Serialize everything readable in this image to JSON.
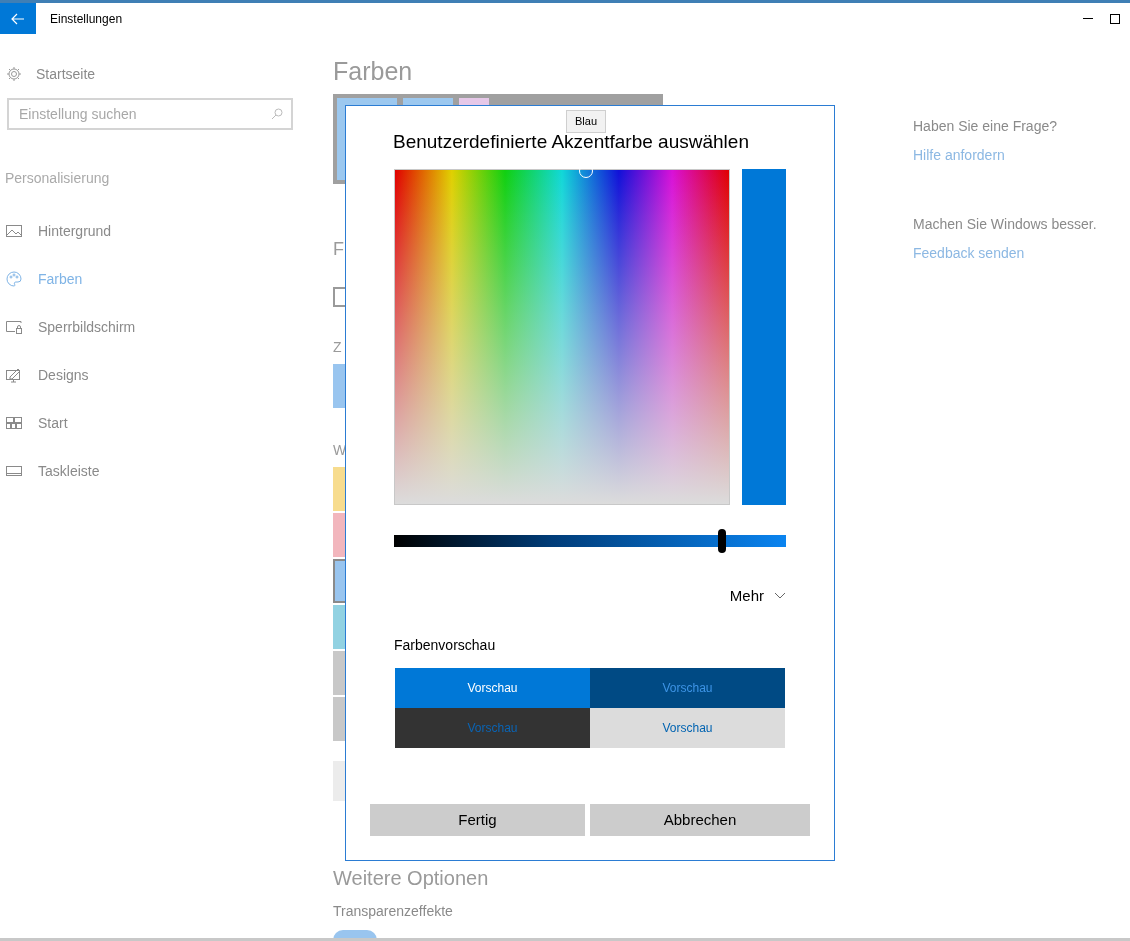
{
  "window": {
    "title": "Einstellungen"
  },
  "sidebar": {
    "home": "Startseite",
    "search": {
      "placeholder": "Einstellung suchen"
    },
    "section": "Personalisierung",
    "items": [
      {
        "label": "Hintergrund",
        "selected": false
      },
      {
        "label": "Farben",
        "selected": true
      },
      {
        "label": "Sperrbildschirm",
        "selected": false
      },
      {
        "label": "Designs",
        "selected": false
      },
      {
        "label": "Start",
        "selected": false
      },
      {
        "label": "Taskleiste",
        "selected": false
      }
    ]
  },
  "main": {
    "title": "Farben",
    "partial_labels": [
      "F",
      "Z",
      "W"
    ],
    "checkbox": {
      "checked": false
    },
    "swatches": [
      {
        "color": "#f7dc8e",
        "selected": false
      },
      {
        "color": "#f2b6bd",
        "selected": false
      },
      {
        "color": "#99c5ef",
        "selected": true
      },
      {
        "color": "#92d2e2",
        "selected": false
      },
      {
        "color": "#c8c8c8",
        "selected": false
      },
      {
        "color": "#c8c8c8",
        "selected": false
      }
    ],
    "section": "Weitere Optionen",
    "transparency_label": "Transparenzeffekte",
    "transparency": {
      "on": true
    }
  },
  "help": {
    "question": "Haben Sie eine Frage?",
    "link": "Hilfe anfordern",
    "feedback_prompt": "Machen Sie Windows besser.",
    "feedback_link": "Feedback senden"
  },
  "dialog": {
    "title": "Benutzerdefinierte Akzentfarbe auswählen",
    "tooltip": "Blau",
    "slider": {
      "level": 0.837
    },
    "more": "Mehr",
    "preview_label": "Farbenvorschau",
    "previews": [
      {
        "label": "Vorschau",
        "kind": "accent",
        "color": "#0078d7"
      },
      {
        "label": "Vorschau",
        "kind": "dim-accent",
        "color": "#004a84"
      },
      {
        "label": "Vorschau",
        "kind": "dim",
        "color": "#333333"
      },
      {
        "label": "Vorschau",
        "kind": "light",
        "color": "#dcdcdc"
      }
    ],
    "buttons": [
      "Fertig",
      "Abbrechen"
    ]
  }
}
